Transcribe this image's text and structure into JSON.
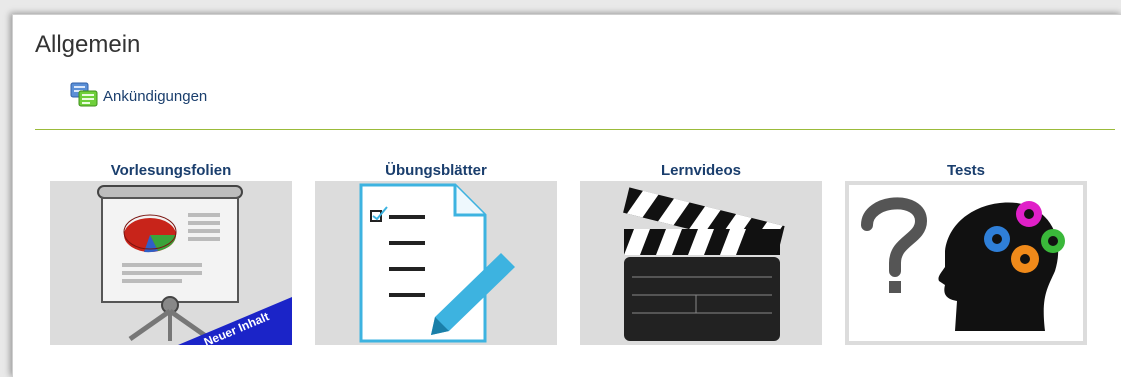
{
  "section": {
    "title": "Allgemein"
  },
  "announcements": {
    "label": "Ankündigungen",
    "icon": "forum-icon"
  },
  "tiles": [
    {
      "label": "Vorlesungsfolien",
      "icon": "presentation-icon",
      "banner": "Neuer Inhalt"
    },
    {
      "label": "Übungsblätter",
      "icon": "worksheet-icon"
    },
    {
      "label": "Lernvideos",
      "icon": "clapperboard-icon"
    },
    {
      "label": "Tests",
      "icon": "brain-gears-icon"
    }
  ],
  "colors": {
    "link": "#1a3e6d",
    "divider": "#9bbb3a",
    "tile_background": "#dcdcdc",
    "banner": "#1b24c8"
  }
}
